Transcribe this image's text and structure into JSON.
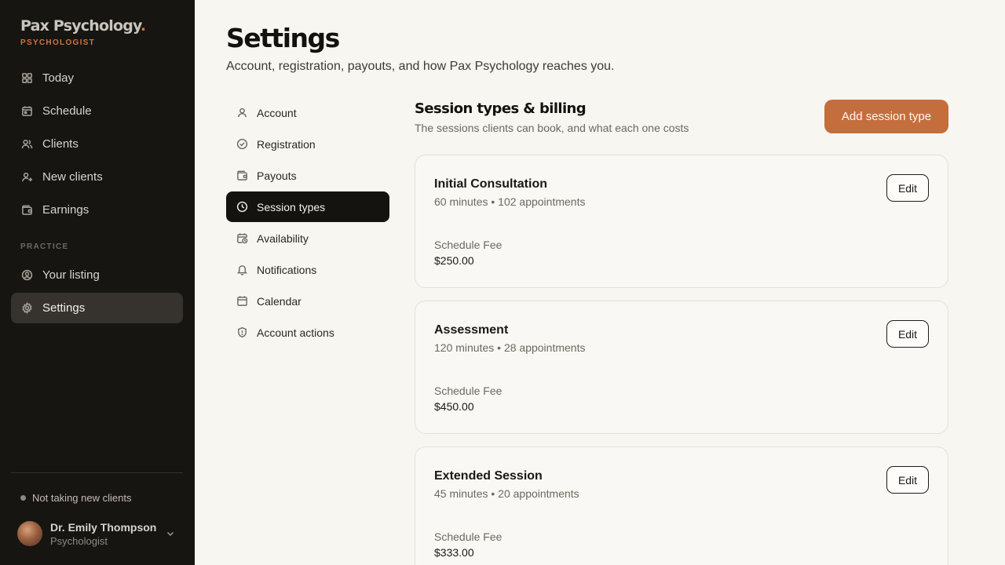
{
  "brand": {
    "name": "Pax Psychology",
    "dot": ".",
    "role": "PSYCHOLOGIST"
  },
  "sidebar": {
    "main_items": [
      {
        "label": "Today",
        "icon": "grid-icon"
      },
      {
        "label": "Schedule",
        "icon": "calendar-icon"
      },
      {
        "label": "Clients",
        "icon": "users-icon"
      },
      {
        "label": "New clients",
        "icon": "user-plus-icon"
      },
      {
        "label": "Earnings",
        "icon": "wallet-icon"
      }
    ],
    "section_label": "PRACTICE",
    "practice_items": [
      {
        "label": "Your listing",
        "icon": "user-circle-icon"
      },
      {
        "label": "Settings",
        "icon": "gear-icon",
        "active": true
      }
    ],
    "status": "Not taking new clients",
    "user": {
      "name": "Dr. Emily Thompson",
      "role": "Psychologist"
    }
  },
  "page": {
    "title": "Settings",
    "subtitle": "Account, registration, payouts, and how Pax Psychology reaches you."
  },
  "subnav": [
    {
      "label": "Account",
      "icon": "user-icon"
    },
    {
      "label": "Registration",
      "icon": "check-circle-icon"
    },
    {
      "label": "Payouts",
      "icon": "wallet-icon"
    },
    {
      "label": "Session types",
      "icon": "clock-icon",
      "active": true
    },
    {
      "label": "Availability",
      "icon": "calendar-clock-icon"
    },
    {
      "label": "Notifications",
      "icon": "bell-icon"
    },
    {
      "label": "Calendar",
      "icon": "calendar-icon"
    },
    {
      "label": "Account actions",
      "icon": "shield-icon"
    }
  ],
  "section": {
    "title": "Session types & billing",
    "subtitle": "The sessions clients can book, and what each one costs",
    "add_label": "Add session type"
  },
  "sessions": [
    {
      "name": "Initial Consultation",
      "meta": "60 minutes • 102 appointments",
      "fee_label": "Schedule Fee",
      "fee": "$250.00",
      "edit_label": "Edit"
    },
    {
      "name": "Assessment",
      "meta": "120 minutes • 28 appointments",
      "fee_label": "Schedule Fee",
      "fee": "$450.00",
      "edit_label": "Edit"
    },
    {
      "name": "Extended Session",
      "meta": "45 minutes • 20 appointments",
      "fee_label": "Schedule Fee",
      "fee": "$333.00",
      "edit_label": "Edit"
    }
  ],
  "colors": {
    "accent": "#c56e3d",
    "sidebar_bg": "#171512",
    "page_bg": "#f8f6f1"
  }
}
